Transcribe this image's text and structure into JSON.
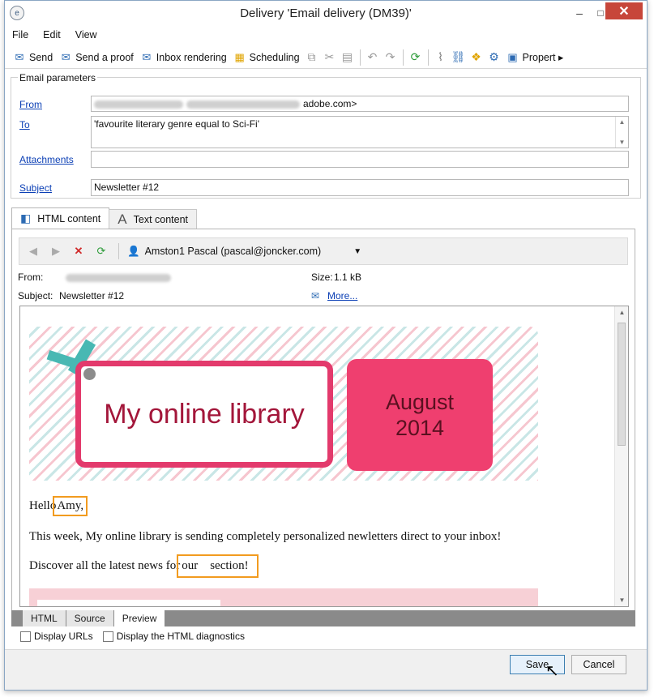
{
  "window": {
    "title": "Delivery 'Email delivery (DM39)'",
    "controls": {
      "minimize": "–",
      "maximize": "□",
      "close": "✕"
    }
  },
  "menu": [
    "File",
    "Edit",
    "View"
  ],
  "toolbar": {
    "send": "Send",
    "send_proof": "Send a proof",
    "inbox_rendering": "Inbox rendering",
    "scheduling": "Scheduling",
    "properties": "Propert ▸"
  },
  "email_parameters": {
    "section_title": "Email parameters",
    "from_label": "From",
    "from_value": "adobe.com>",
    "to_label": "To",
    "to_value": "'favourite literary genre equal to Sci-Fi'",
    "attachments_label": "Attachments",
    "attachments_value": "",
    "subject_label": "Subject",
    "subject_value": "Newsletter #12"
  },
  "tabs": {
    "html_content": "HTML content",
    "text_content": "Text content"
  },
  "preview": {
    "recipient": "Amston1 Pascal (pascal@joncker.com)",
    "from_label": "From:",
    "subject_label": "Subject:",
    "subject_value": "Newsletter #12",
    "size_label": "Size:",
    "size_value": "1.1 kB",
    "more_link": "More..."
  },
  "email": {
    "banner_title": "My online library",
    "banner_date": "August\n2014",
    "greeting_prefix": "Hello",
    "greeting_name": "Amy,",
    "line1": "This week, My online library is sending completely personalized newletters direct to your inbox!",
    "line2_prefix": "Discover all the latest news for",
    "line2_highlight": "our    section!"
  },
  "bottom_tabs": [
    "HTML",
    "Source",
    "Preview"
  ],
  "options": {
    "display_urls": "Display URLs",
    "display_diagnostics": "Display the HTML diagnostics"
  },
  "buttons": {
    "save": "Save",
    "cancel": "Cancel"
  },
  "colors": {
    "link": "#0b3fb5",
    "banner_pink": "#e33a6c",
    "banner_text": "#a3163a",
    "highlight": "#f29b1f",
    "close_red": "#c7463a"
  }
}
